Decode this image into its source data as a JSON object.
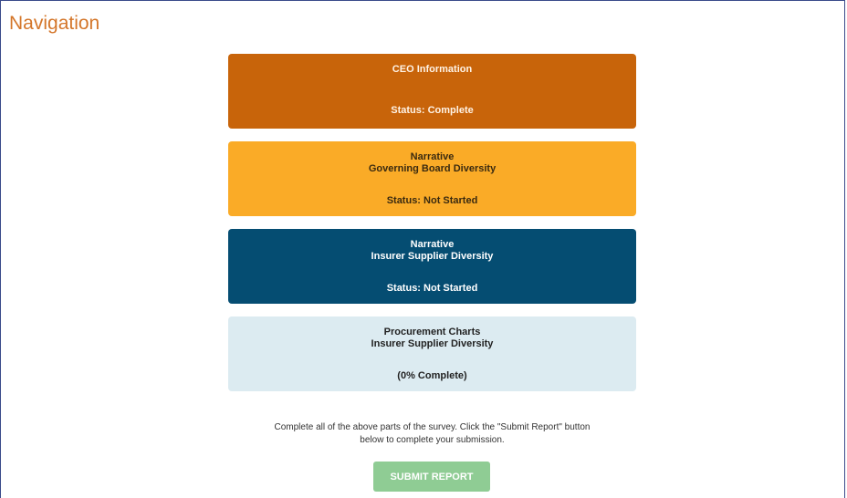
{
  "page": {
    "title": "Navigation"
  },
  "cards": [
    {
      "line1": "CEO Information",
      "line2": "",
      "status": "Status: Complete"
    },
    {
      "line1": "Narrative",
      "line2": "Governing Board Diversity",
      "status": "Status: Not Started"
    },
    {
      "line1": "Narrative",
      "line2": "Insurer Supplier Diversity",
      "status": "Status: Not Started"
    },
    {
      "line1": "Procurement Charts",
      "line2": "Insurer Supplier Diversity",
      "status": "(0% Complete)"
    }
  ],
  "instructions": {
    "line1": "Complete all of the above parts of the survey. Click the \"Submit Report\" button",
    "line2": "below to complete your submission."
  },
  "submit": {
    "label": "SUBMIT REPORT",
    "disabled": true
  },
  "colors": {
    "title": "#d4762a",
    "ceo_card": "#c8640a",
    "board_card": "#faab27",
    "supplier_card": "#054d72",
    "procurement_card": "#dcebf1",
    "submit_button": "#8fcc94"
  }
}
